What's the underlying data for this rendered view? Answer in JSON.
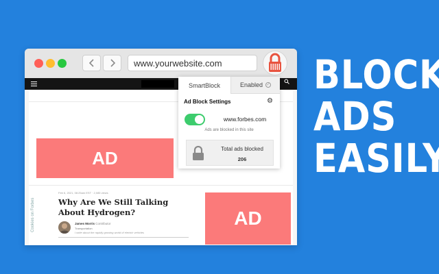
{
  "browser": {
    "url": "www.yourwebsite.com",
    "icons": {
      "back": "chevron-left-icon",
      "forward": "chevron-right-icon",
      "extension": "lock-icon"
    }
  },
  "popup": {
    "tabs": [
      "SmartBlock",
      "Enabled"
    ],
    "title": "Ad Block Settings",
    "site": "www.forbes.com",
    "blocked_note": "Ads are blocked in this site",
    "total_label": "Total ads blocked",
    "total_count": "206",
    "toggle_on": true,
    "toggle_color": "#3dcc6d"
  },
  "page": {
    "ad_label": "AD",
    "ad_color": "#fb7a7a",
    "side_label": "Cookies on Forbes",
    "meta": "Feb 6, 2021, 08:25am EST  ·  2,085 views",
    "article_title": "Why Are We Still Talking About Hydrogen?",
    "author_name": "James Morris",
    "author_contrib": "Contributor",
    "author_role": "Transportation",
    "author_desc": "I write about the rapidly growing world of electric vehicles"
  },
  "headline": [
    "BLOCK",
    "ADS",
    "EASILY"
  ],
  "colors": {
    "background": "#2381dd",
    "accent_red": "#e8533f"
  }
}
